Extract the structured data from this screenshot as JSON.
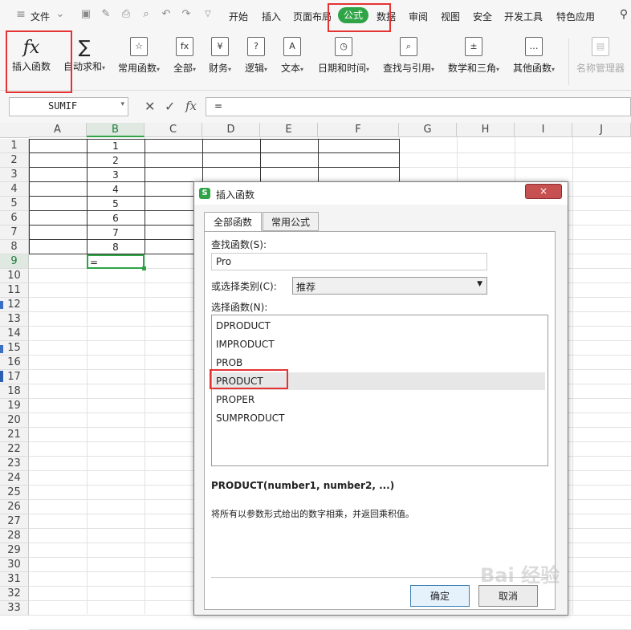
{
  "menubar": {
    "file_label": "文件",
    "tabs": [
      "开始",
      "插入",
      "页面布局",
      "公式",
      "数据",
      "审阅",
      "视图",
      "安全",
      "开发工具",
      "特色应用"
    ],
    "active_tab": "公式"
  },
  "ribbon": {
    "insert_function": "插入函数",
    "autosum": "自动求和",
    "groups": [
      "常用函数",
      "全部",
      "财务",
      "逻辑",
      "文本",
      "日期和时间",
      "查找与引用",
      "数学和三角",
      "其他函数"
    ],
    "name_manager": "名称管理器"
  },
  "formula_bar": {
    "name_box": "SUMIF",
    "formula": "="
  },
  "sheet": {
    "columns": [
      "A",
      "B",
      "C",
      "D",
      "E",
      "F",
      "G",
      "H",
      "I",
      "J"
    ],
    "rows": [
      "1",
      "2",
      "3",
      "4",
      "5",
      "6",
      "7",
      "8",
      "9",
      "10",
      "11",
      "12",
      "13",
      "14",
      "15",
      "16",
      "17",
      "18",
      "19",
      "20",
      "21",
      "22",
      "23",
      "24",
      "25",
      "26",
      "27",
      "28",
      "29",
      "30",
      "31",
      "32",
      "33"
    ],
    "values_b": [
      "1",
      "2",
      "3",
      "4",
      "5",
      "6",
      "7",
      "8"
    ],
    "active_cell_text": "="
  },
  "dialog": {
    "title": "插入函数",
    "close": "×",
    "tabs": [
      "全部函数",
      "常用公式"
    ],
    "search_label": "查找函数(S):",
    "search_value": "Pro",
    "category_label": "或选择类别(C):",
    "category_value": "推荐",
    "list_label": "选择函数(N):",
    "functions": [
      "DPRODUCT",
      "IMPRODUCT",
      "PROB",
      "PRODUCT",
      "PROPER",
      "SUMPRODUCT"
    ],
    "selected_function": "PRODUCT",
    "signature": "PRODUCT(number1, number2, ...)",
    "description": "将所有以参数形式给出的数字相乘，并返回乘积值。",
    "ok": "确定",
    "cancel": "取消"
  },
  "watermark": "Bai 经验",
  "colors": {
    "accent": "#2fa446",
    "highlight": "#e53333"
  }
}
